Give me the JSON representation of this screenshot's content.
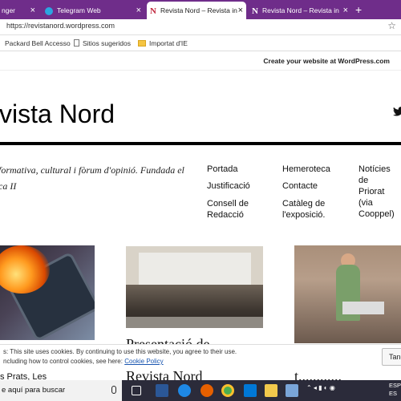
{
  "browser": {
    "tabs": [
      {
        "label": "nger",
        "favicon": "messenger-icon",
        "active": false
      },
      {
        "label": "Telegram Web",
        "favicon": "telegram-icon",
        "active": false
      },
      {
        "label": "Revista Nord – Revista in",
        "favicon": "revista-nord-icon",
        "active": true
      },
      {
        "label": "Revista Nord – Revista in",
        "favicon": "revista-nord-icon",
        "active": false
      }
    ],
    "address": "https://revistanord.wordpress.com",
    "bookmarks": [
      "Packard Bell Accesso",
      "Sitios sugeridos",
      "Importat d'IE"
    ]
  },
  "wp_bar": {
    "link": "Create your website at WordPress.com"
  },
  "site": {
    "title": "vista Nord",
    "tagline_lines": [
      "formativa, cultural i fòrum d'opinió. Fundada el",
      "ca II"
    ]
  },
  "menu": {
    "col1": [
      "Portada",
      "Justificació",
      "Consell de",
      "Redacció"
    ],
    "col2": [
      "Hemeroteca",
      "Contacte",
      "Catàleg de",
      "l'exposició."
    ],
    "col3": [
      "Notícies de",
      "Priorat (via",
      "Cooppel)"
    ]
  },
  "posts": [
    {
      "image": "burning-phone",
      "subtitle": "s Prats, Les"
    },
    {
      "image": "group-photo",
      "title_lines": [
        "Presentació de",
        "Revista Nord"
      ]
    },
    {
      "image": "man-at-desk-cave",
      "title": "t............"
    }
  ],
  "cookie": {
    "line1": "s: This site uses cookies. By continuing to use this website, you agree to their use.",
    "line2_prefix": "ncluding how to control cookies, see here: ",
    "line2_link": "Cookie Policy",
    "button": "Tanc"
  },
  "taskbar": {
    "search_placeholder": "e aquí para buscar",
    "lang": "ESP",
    "lang2": "ES"
  },
  "colors": {
    "tabstrip": "#6f2d8a",
    "taskbar": "#2b2b3a",
    "link": "#1a56b0"
  }
}
